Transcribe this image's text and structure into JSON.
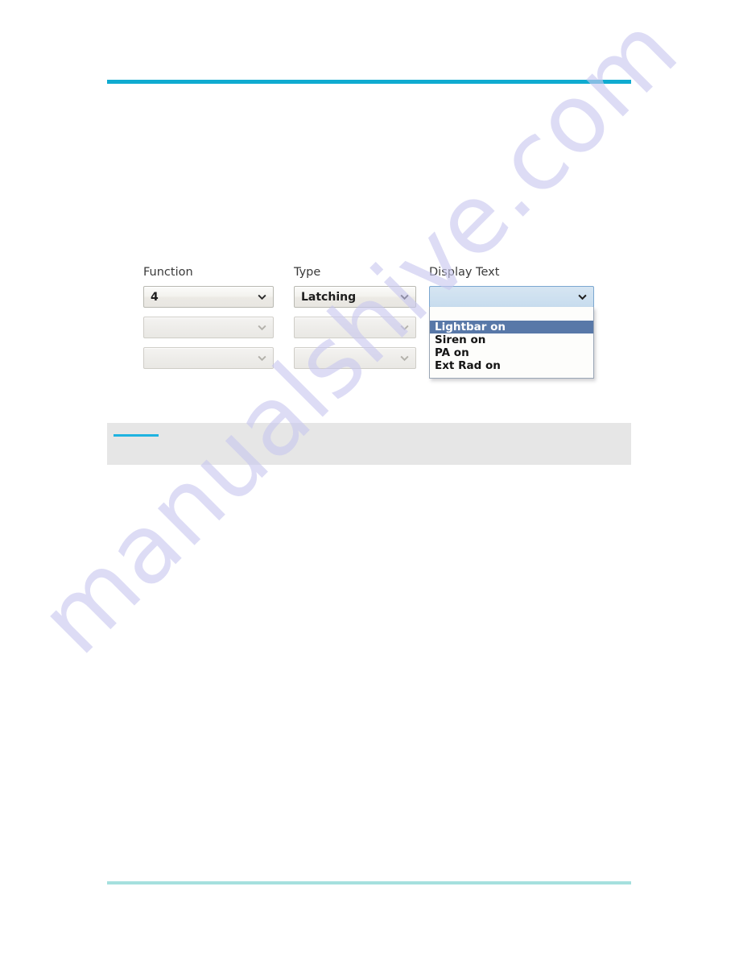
{
  "document": {
    "watermark": "manualshive.com",
    "accent_color": "#0fabd0",
    "accent_color_light": "#a5e0de",
    "gray_block_color": "#e6e6e6"
  },
  "form": {
    "columns": [
      {
        "label": "Function",
        "fields": [
          {
            "value": "4",
            "state": "enabled"
          },
          {
            "value": "",
            "state": "disabled"
          },
          {
            "value": "",
            "state": "disabled"
          }
        ]
      },
      {
        "label": "Type",
        "fields": [
          {
            "value": "Latching",
            "state": "enabled"
          },
          {
            "value": "",
            "state": "disabled"
          },
          {
            "value": "",
            "state": "disabled"
          }
        ]
      },
      {
        "label": "Display Text",
        "fields": [
          {
            "value": "",
            "state": "active-open"
          }
        ]
      }
    ],
    "display_text_dropdown": {
      "selected": "Lightbar on",
      "options": [
        {
          "label": "",
          "selected": false
        },
        {
          "label": "Lightbar on",
          "selected": true
        },
        {
          "label": "Siren on",
          "selected": false
        },
        {
          "label": "PA on",
          "selected": false
        },
        {
          "label": "Ext Rad on",
          "selected": false
        }
      ],
      "highlight_color": "#5878a8"
    }
  }
}
